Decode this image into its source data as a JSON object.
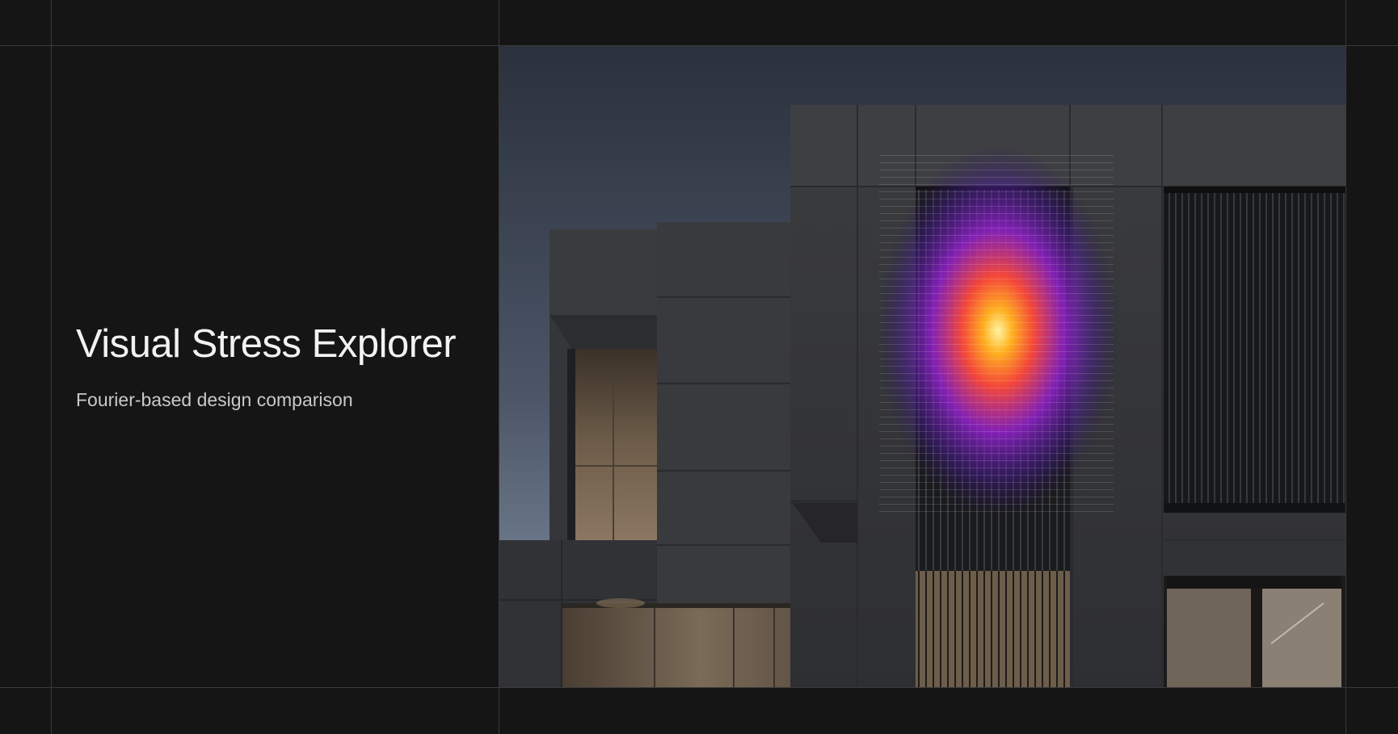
{
  "header": {
    "title": "Visual Stress Explorer",
    "subtitle": "Fourier-based design comparison"
  },
  "viewer": {
    "image_subject": "building-facade",
    "overlay": "stress-heatmap"
  },
  "colors": {
    "background": "#151515",
    "gridline": "#3a3a3a",
    "title": "#f2f2f2",
    "subtitle": "#c9c9c9",
    "heat_core": "#ffe066",
    "heat_mid": "#ff6a1a",
    "heat_outer": "#8a2be2"
  }
}
